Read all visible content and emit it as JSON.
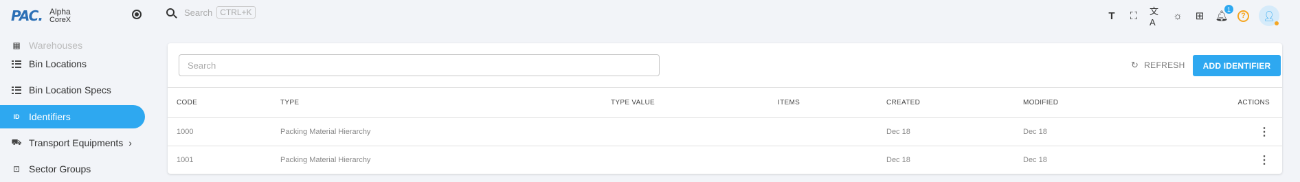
{
  "brand": {
    "logo": "PAC.",
    "name": "Alpha",
    "sub": "CoreX"
  },
  "sidebar": {
    "items": [
      {
        "label": "Warehouses",
        "icon": "warehouse-icon",
        "state": "faded"
      },
      {
        "label": "Bin Locations",
        "icon": "list-icon"
      },
      {
        "label": "Bin Location Specs",
        "icon": "list-icon"
      },
      {
        "label": "Identifiers",
        "icon": "id-icon",
        "active": true
      },
      {
        "label": "Transport Equipments",
        "icon": "forklift-icon",
        "has_children": true
      },
      {
        "label": "Sector Groups",
        "icon": "sector-icon"
      }
    ]
  },
  "topbar": {
    "search_placeholder": "Search",
    "shortcut": "CTRL+K",
    "notification_count": "1",
    "help": "?"
  },
  "toolbar": {
    "search_placeholder": "Search",
    "refresh_label": "REFRESH",
    "add_label": "ADD IDENTIFIER"
  },
  "table": {
    "headers": [
      "CODE",
      "TYPE",
      "TYPE VALUE",
      "ITEMS",
      "CREATED",
      "MODIFIED",
      "ACTIONS"
    ],
    "rows": [
      {
        "code": "1000",
        "type": "Packing Material Hierarchy",
        "type_value": "",
        "items": "",
        "created": "Dec 18",
        "modified": "Dec 18"
      },
      {
        "code": "1001",
        "type": "Packing Material Hierarchy",
        "type_value": "",
        "items": "",
        "created": "Dec 18",
        "modified": "Dec 18"
      }
    ]
  },
  "colors": {
    "accent": "#2ea8f0",
    "logo": "#2b6fb5",
    "help": "#f5a623",
    "background": "#f2f4f8"
  }
}
